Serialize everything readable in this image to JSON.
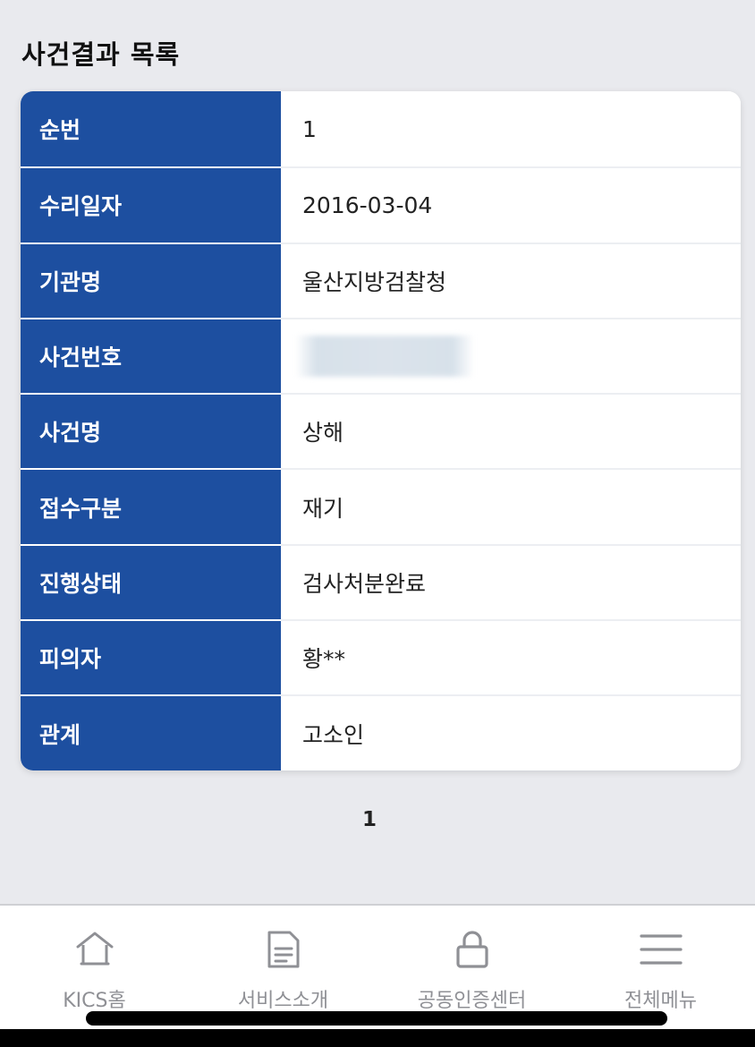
{
  "header": {
    "title": "사건결과 목록"
  },
  "result_table": {
    "rows": [
      {
        "label": "순번",
        "value": "1"
      },
      {
        "label": "수리일자",
        "value": "2016-03-04"
      },
      {
        "label": "기관명",
        "value": "울산지방검찰청"
      },
      {
        "label": "사건번호",
        "value": ""
      },
      {
        "label": "사건명",
        "value": "상해"
      },
      {
        "label": "접수구분",
        "value": "재기"
      },
      {
        "label": "진행상태",
        "value": "검사처분완료"
      },
      {
        "label": "피의자",
        "value": "황**"
      },
      {
        "label": "관계",
        "value": "고소인"
      }
    ]
  },
  "pagination": {
    "current_page": "1"
  },
  "bottom_nav": {
    "items": [
      {
        "label": "KICS홈",
        "icon": "home-icon"
      },
      {
        "label": "서비스소개",
        "icon": "document-icon"
      },
      {
        "label": "공동인증센터",
        "icon": "lock-icon"
      },
      {
        "label": "전체메뉴",
        "icon": "menu-icon"
      }
    ]
  },
  "colors": {
    "label_background": "#1d4fa0",
    "page_background": "#e9eaee",
    "nav_text": "#8f9095"
  }
}
